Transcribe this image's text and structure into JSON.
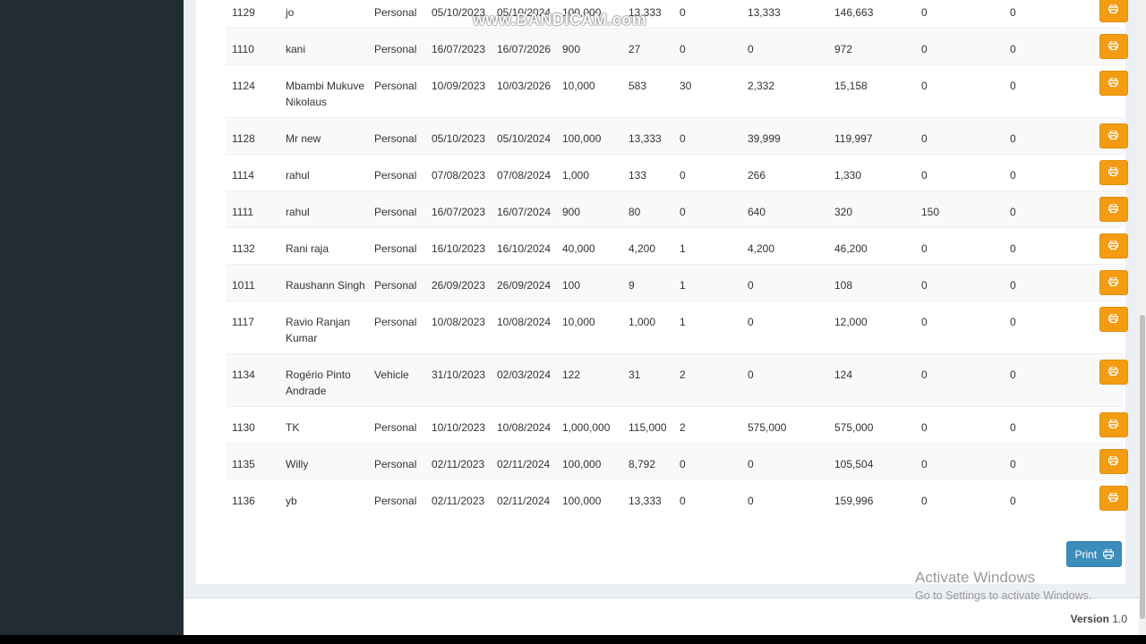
{
  "table": {
    "rows": [
      {
        "id": "1129",
        "name": "jo",
        "type": "Personal",
        "start": "05/10/2023",
        "end": "05/10/2024",
        "amount": "100,000",
        "emi": "13,333",
        "count": "0",
        "interest": "13,333",
        "total": "146,663",
        "paid": "0",
        "due": "0"
      },
      {
        "id": "1110",
        "name": "kani",
        "type": "Personal",
        "start": "16/07/2023",
        "end": "16/07/2026",
        "amount": "900",
        "emi": "27",
        "count": "0",
        "interest": "0",
        "total": "972",
        "paid": "0",
        "due": "0"
      },
      {
        "id": "1124",
        "name": "Mbambi Mukuve Nikolaus",
        "type": "Personal",
        "start": "10/09/2023",
        "end": "10/03/2026",
        "amount": "10,000",
        "emi": "583",
        "count": "30",
        "interest": "2,332",
        "total": "15,158",
        "paid": "0",
        "due": "0"
      },
      {
        "id": "1128",
        "name": "Mr new",
        "type": "Personal",
        "start": "05/10/2023",
        "end": "05/10/2024",
        "amount": "100,000",
        "emi": "13,333",
        "count": "0",
        "interest": "39,999",
        "total": "119,997",
        "paid": "0",
        "due": "0"
      },
      {
        "id": "1114",
        "name": "rahul",
        "type": "Personal",
        "start": "07/08/2023",
        "end": "07/08/2024",
        "amount": "1,000",
        "emi": "133",
        "count": "0",
        "interest": "266",
        "total": "1,330",
        "paid": "0",
        "due": "0"
      },
      {
        "id": "1111",
        "name": "rahul",
        "type": "Personal",
        "start": "16/07/2023",
        "end": "16/07/2024",
        "amount": "900",
        "emi": "80",
        "count": "0",
        "interest": "640",
        "total": "320",
        "paid": "150",
        "due": "0"
      },
      {
        "id": "1132",
        "name": "Rani raja",
        "type": "Personal",
        "start": "16/10/2023",
        "end": "16/10/2024",
        "amount": "40,000",
        "emi": "4,200",
        "count": "1",
        "interest": "4,200",
        "total": "46,200",
        "paid": "0",
        "due": "0"
      },
      {
        "id": "1011",
        "name": "Raushann Singh",
        "type": "Personal",
        "start": "26/09/2023",
        "end": "26/09/2024",
        "amount": "100",
        "emi": "9",
        "count": "1",
        "interest": "0",
        "total": "108",
        "paid": "0",
        "due": "0"
      },
      {
        "id": "1117",
        "name": "Ravio Ranjan Kumar",
        "type": "Personal",
        "start": "10/08/2023",
        "end": "10/08/2024",
        "amount": "10,000",
        "emi": "1,000",
        "count": "1",
        "interest": "0",
        "total": "12,000",
        "paid": "0",
        "due": "0"
      },
      {
        "id": "1134",
        "name": "Rogério Pinto Andrade",
        "type": "Vehicle",
        "start": "31/10/2023",
        "end": "02/03/2024",
        "amount": "122",
        "emi": "31",
        "count": "2",
        "interest": "0",
        "total": "124",
        "paid": "0",
        "due": "0"
      },
      {
        "id": "1130",
        "name": "TK",
        "type": "Personal",
        "start": "10/10/2023",
        "end": "10/08/2024",
        "amount": "1,000,000",
        "emi": "115,000",
        "count": "2",
        "interest": "575,000",
        "total": "575,000",
        "paid": "0",
        "due": "0"
      },
      {
        "id": "1135",
        "name": "Willy",
        "type": "Personal",
        "start": "02/11/2023",
        "end": "02/11/2024",
        "amount": "100,000",
        "emi": "8,792",
        "count": "0",
        "interest": "0",
        "total": "105,504",
        "paid": "0",
        "due": "0"
      },
      {
        "id": "1136",
        "name": "yb",
        "type": "Personal",
        "start": "02/11/2023",
        "end": "02/11/2024",
        "amount": "100,000",
        "emi": "13,333",
        "count": "0",
        "interest": "0",
        "total": "159,996",
        "paid": "0",
        "due": "0"
      }
    ]
  },
  "print_button": {
    "label": "Print"
  },
  "footer": {
    "version_label": "Version",
    "version_number": "1.0"
  },
  "overlay": {
    "recorder_watermark": "www.BANDICAM.com",
    "activate_title": "Activate Windows",
    "activate_subtitle": "Go to Settings to activate Windows."
  },
  "colors": {
    "sidebar": "#222d32",
    "row_print_button": "#f39c12",
    "print_button": "#3c8dbc"
  }
}
